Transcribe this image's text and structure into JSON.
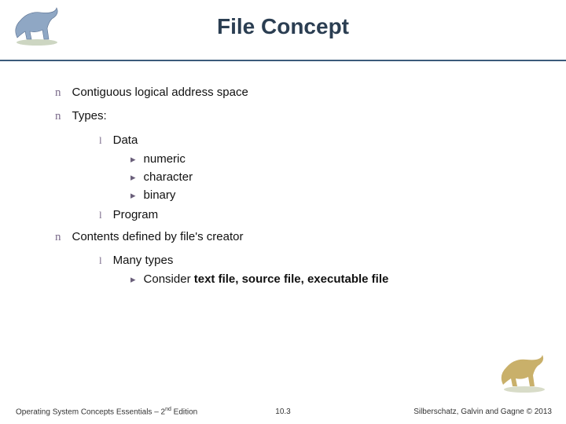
{
  "title": "File Concept",
  "bullets": {
    "b1": "Contiguous logical address space",
    "b2": "Types:",
    "b2_1": "Data",
    "b2_1_1": "numeric",
    "b2_1_2": "character",
    "b2_1_3": "binary",
    "b2_2": "Program",
    "b3": "Contents defined by file's creator",
    "b3_1": "Many types",
    "b3_1_1a": "Consider ",
    "b3_1_1b": "text file, source file, executable file"
  },
  "marks": {
    "n": "n",
    "l": "l",
    "arrow": "▸"
  },
  "footer": {
    "left_a": "Operating System Concepts Essentials – 2",
    "left_sup": "nd",
    "left_b": " Edition",
    "center": "10.3",
    "right": "Silberschatz, Galvin and Gagne © 2013"
  },
  "icons": {
    "dino_tl": "dinosaur-icon",
    "dino_br": "dinosaur-icon"
  }
}
